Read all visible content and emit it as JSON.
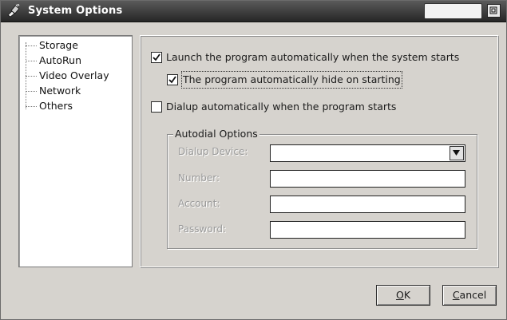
{
  "window": {
    "title": "System Options"
  },
  "tree": {
    "items": [
      {
        "label": "Storage"
      },
      {
        "label": "AutoRun"
      },
      {
        "label": "Video Overlay"
      },
      {
        "label": "Network"
      },
      {
        "label": "Others"
      }
    ]
  },
  "options": {
    "launch_auto": {
      "label": "Launch the program automatically when the system starts",
      "checked": true
    },
    "auto_hide": {
      "label": "The program automatically hide on starting",
      "checked": true
    },
    "dialup_auto": {
      "label": "Dialup automatically when the program starts",
      "checked": false
    }
  },
  "autodial": {
    "group_title": "Autodial Options",
    "fields": {
      "dialup_device": {
        "label": "Dialup Device:",
        "value": ""
      },
      "number": {
        "label": "Number:",
        "value": ""
      },
      "account": {
        "label": "Account:",
        "value": ""
      },
      "password": {
        "label": "Password:",
        "value": ""
      }
    }
  },
  "buttons": {
    "ok_first": "O",
    "ok_rest": "K",
    "cancel_first": "C",
    "cancel_rest": "ancel"
  },
  "icons": {
    "title_icon": "network-plug-icon",
    "restore": "window-restore-icon",
    "dropdown": "chevron-down-icon",
    "check": "checkmark-icon"
  }
}
